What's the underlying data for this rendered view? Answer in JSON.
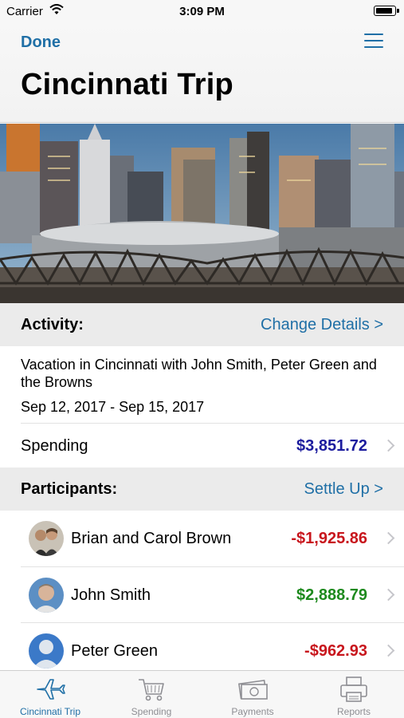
{
  "status_bar": {
    "carrier": "Carrier",
    "time": "3:09 PM"
  },
  "nav": {
    "done_label": "Done",
    "title": "Cincinnati Trip"
  },
  "activity": {
    "header_label": "Activity:",
    "change_details_label": "Change Details >",
    "description": "Vacation in Cincinnati with John Smith, Peter Green and the Browns",
    "dates": "Sep 12, 2017 - Sep 15, 2017",
    "spending_label": "Spending",
    "spending_total": "$3,851.72"
  },
  "participants": {
    "header_label": "Participants:",
    "settle_up_label": "Settle Up >",
    "items": [
      {
        "name": "Brian and Carol Brown",
        "amount": "-$1,925.86"
      },
      {
        "name": "John Smith",
        "amount": "$2,888.79"
      },
      {
        "name": "Peter Green",
        "amount": "-$962.93"
      }
    ]
  },
  "tabs": [
    {
      "label": "Cincinnati Trip",
      "icon": "airplane-icon",
      "active": true
    },
    {
      "label": "Spending",
      "icon": "shopping-cart-icon",
      "active": false
    },
    {
      "label": "Payments",
      "icon": "money-icon",
      "active": false
    },
    {
      "label": "Reports",
      "icon": "printer-icon",
      "active": false
    }
  ],
  "colors": {
    "accent": "#1f6fa6",
    "negative": "#c8161d",
    "positive": "#1e8a1e",
    "total": "#1c1c9e"
  }
}
